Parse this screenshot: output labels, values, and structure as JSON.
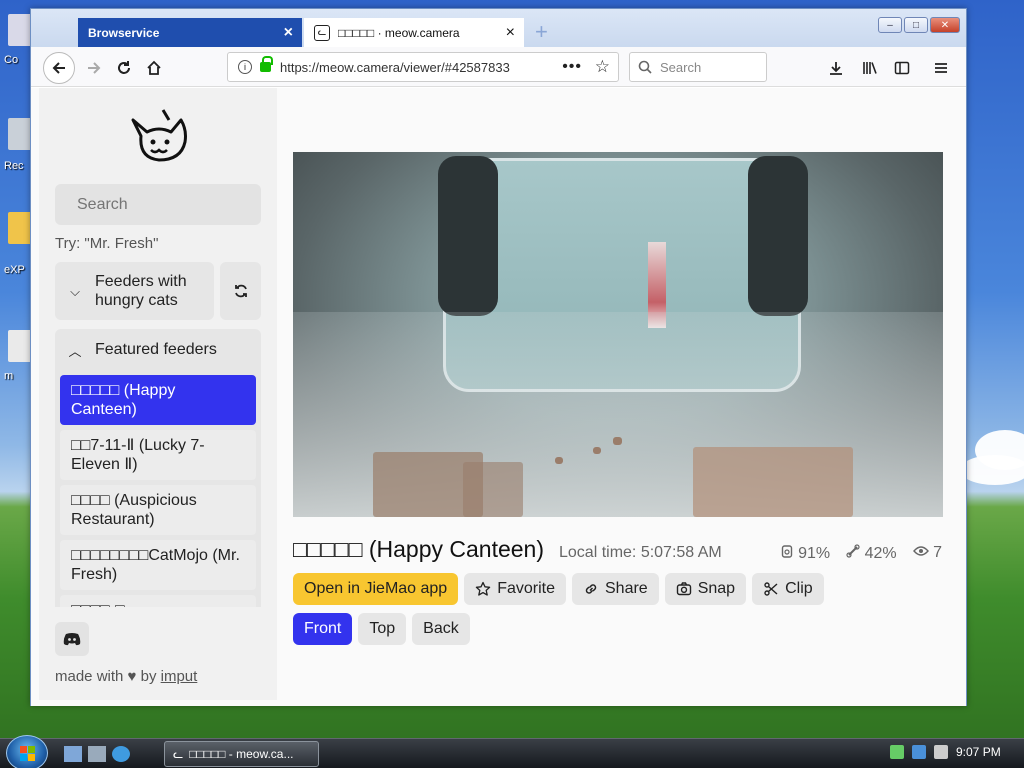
{
  "desktop": {
    "labels": [
      "Co",
      "Rec",
      "eXP",
      "m"
    ]
  },
  "browser": {
    "tabs": [
      {
        "label": "Browservice",
        "close": "×"
      },
      {
        "label": "□□□□□ · meow.camera",
        "close": "×"
      }
    ],
    "new_tab": "+",
    "window_buttons": {
      "minimize": "–",
      "maximize": "□",
      "close": "✕"
    },
    "url": "https://meow.camera/viewer/#42587833",
    "url_more": "•••",
    "search_placeholder": "Search"
  },
  "sidebar": {
    "search_placeholder": "Search",
    "hint": "Try: \"Mr. Fresh\"",
    "hungry_label": "Feeders with hungry cats",
    "featured_label": "Featured feeders",
    "feeders": [
      {
        "label": "□□□□□ (Happy Canteen)",
        "active": true
      },
      {
        "label": "□□7-11-Ⅱ (Lucky 7-Eleven Ⅱ)",
        "active": false
      },
      {
        "label": "□□□□ (Auspicious Restaurant)",
        "active": false
      },
      {
        "label": "□□□□□□□□CatMojo (Mr. Fresh)",
        "active": false
      },
      {
        "label": "□□□□-□",
        "active": false
      }
    ],
    "credit_prefix": "made with",
    "credit_by": "by",
    "credit_link": "imput"
  },
  "viewer": {
    "title": "□□□□□ (Happy Canteen)",
    "local_time": "Local time: 5:07:58 AM",
    "stats": {
      "food": "91%",
      "bowl": "42%",
      "viewers": "7"
    },
    "actions": {
      "open_app": "Open in JieMao app",
      "favorite": "Favorite",
      "share": "Share",
      "snap": "Snap",
      "clip": "Clip"
    },
    "cameras": [
      {
        "label": "Front",
        "active": true
      },
      {
        "label": "Top",
        "active": false
      },
      {
        "label": "Back",
        "active": false
      }
    ]
  },
  "taskbar": {
    "task_label": "□□□□□ - meow.ca...",
    "clock": "9:07 PM"
  },
  "colors": {
    "accent": "#3333ee",
    "yellow": "#f8c630",
    "xp_title": "#1f4eae"
  }
}
